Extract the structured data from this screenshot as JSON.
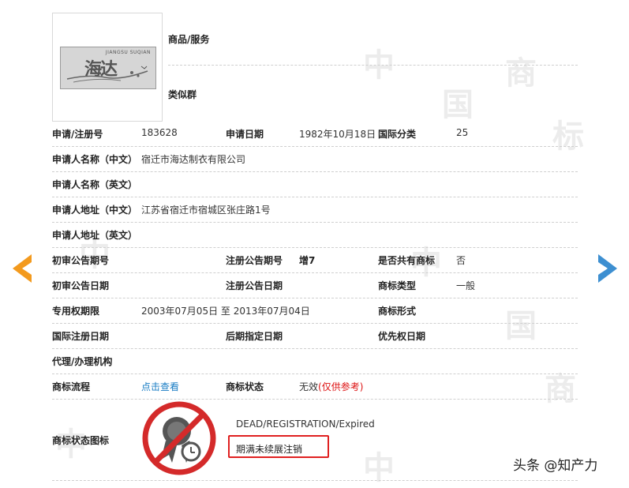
{
  "top": {
    "goods_label": "商品/服务",
    "similar_label": "类似群",
    "logo_small_text": "JIANGSU SUQIAN",
    "logo_big_text": "海达"
  },
  "rows": {
    "r1": {
      "l1": "申请/注册号",
      "v1": "183628",
      "l2": "申请日期",
      "v2": "1982年10月18日",
      "l3": "国际分类",
      "v3": "25"
    },
    "r2": {
      "l1": "申请人名称（中文）",
      "v1": "宿迁市海达制衣有限公司"
    },
    "r3": {
      "l1": "申请人名称（英文）"
    },
    "r4": {
      "l1": "申请人地址（中文）",
      "v1": "江苏省宿迁市宿城区张庄路1号"
    },
    "r5": {
      "l1": "申请人地址（英文）"
    },
    "r6": {
      "l1": "初审公告期号",
      "l2": "注册公告期号",
      "v2": "增7",
      "l3": "是否共有商标",
      "v3": "否"
    },
    "r7": {
      "l1": "初审公告日期",
      "l2": "注册公告日期",
      "l3": "商标类型",
      "v3": "一般"
    },
    "r8": {
      "l1": "专用权期限",
      "v1": "2003年07月05日 至 2013年07月04日",
      "l3": "商标形式"
    },
    "r9": {
      "l1": "国际注册日期",
      "l2": "后期指定日期",
      "l3": "优先权日期"
    },
    "r10": {
      "l1": "代理/办理机构"
    },
    "r11": {
      "l1": "商标流程",
      "v1": "点击查看",
      "l2": "商标状态",
      "v2": "无效",
      "v2b": "(仅供参考)"
    },
    "r12": {
      "l1": "商标状态图标"
    }
  },
  "status": {
    "en": "DEAD/REGISTRATION/Expired",
    "cn": "期满未续展注销"
  },
  "watermark": {
    "text": "头条 @知产力"
  },
  "colors": {
    "arrow_left": "#f39a1e",
    "arrow_right": "#3d8fd1",
    "link": "#1a7dc4",
    "alert_red": "#e02020"
  }
}
